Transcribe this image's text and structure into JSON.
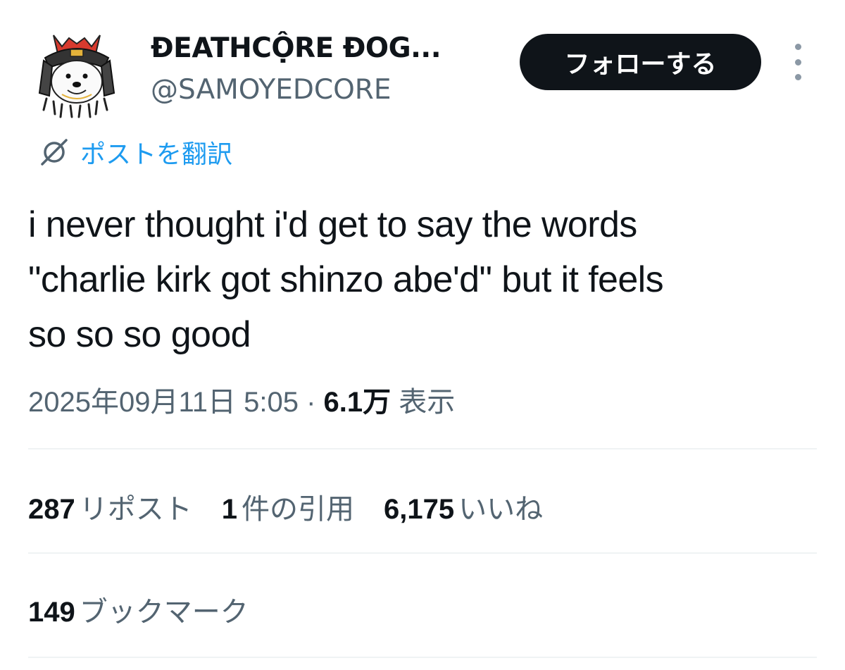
{
  "user": {
    "display_name": "ĐEATHCỘRE ĐOG...",
    "handle": "@SAMOYEDCORE",
    "avatar_icon": "samoyed-samurai-avatar"
  },
  "header": {
    "follow_label": "フォローする",
    "more_icon": "more-vertical-icon"
  },
  "translate": {
    "label": "ポストを翻訳",
    "icon": "globe-icon"
  },
  "tweet": {
    "lines": [
      "i never thought i'd get to say the words",
      "\"charlie kirk got shinzo abe'd\" but it feels",
      "so so so good"
    ]
  },
  "meta": {
    "timestamp": "2025年09月11日 5:05",
    "separator": "·",
    "views_count": "6.1万",
    "views_label": "表示"
  },
  "stats": {
    "reposts": {
      "count": "287",
      "label": "リポスト"
    },
    "quotes": {
      "count": "1",
      "label": "件の引用"
    },
    "likes": {
      "count": "6,175",
      "label": "いいね"
    },
    "bookmarks": {
      "count": "149",
      "label": "ブックマーク"
    }
  },
  "colors": {
    "accent": "#1d9bf0",
    "text": "#0f1419",
    "secondary": "#536471",
    "button_bg": "#0f1419",
    "divider": "#eff3f4"
  }
}
